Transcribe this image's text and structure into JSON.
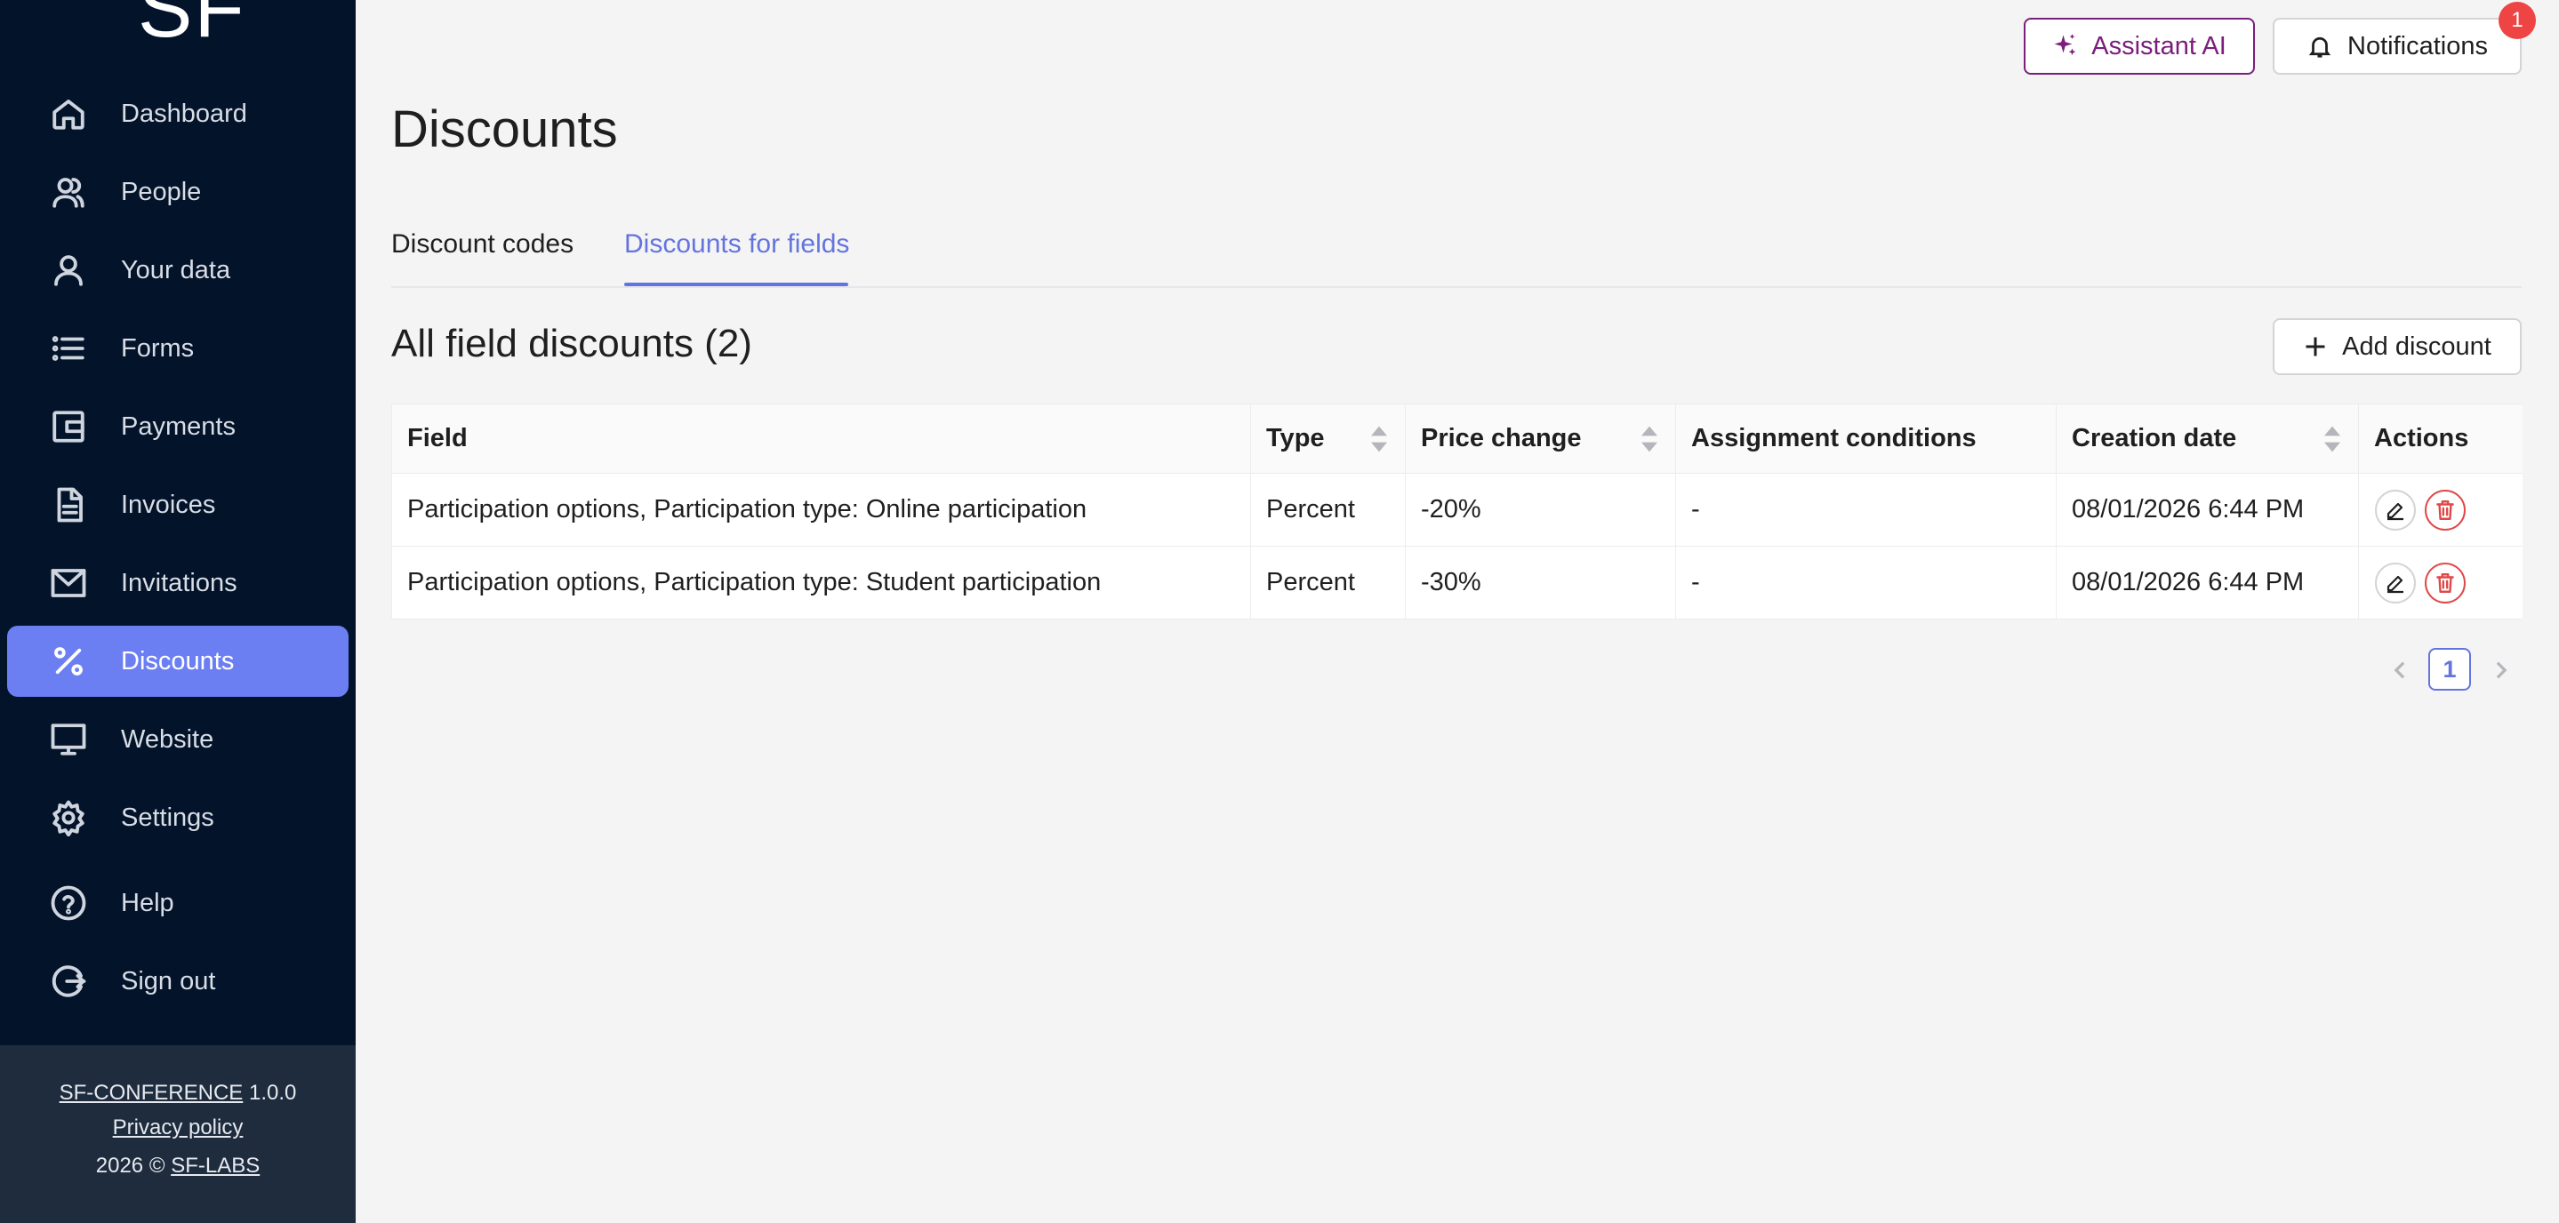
{
  "sidebar": {
    "logo": "SF",
    "items": [
      {
        "label": "Dashboard",
        "icon": "home-icon"
      },
      {
        "label": "People",
        "icon": "people-icon"
      },
      {
        "label": "Your data",
        "icon": "user-icon"
      },
      {
        "label": "Forms",
        "icon": "list-icon"
      },
      {
        "label": "Payments",
        "icon": "wallet-icon"
      },
      {
        "label": "Invoices",
        "icon": "document-icon"
      },
      {
        "label": "Invitations",
        "icon": "mail-icon"
      },
      {
        "label": "Discounts",
        "icon": "percent-icon",
        "active": true
      },
      {
        "label": "Website",
        "icon": "monitor-icon"
      },
      {
        "label": "Settings",
        "icon": "gear-icon"
      },
      {
        "label": "Help",
        "icon": "help-icon"
      },
      {
        "label": "Sign out",
        "icon": "sign-out-icon"
      }
    ],
    "footer": {
      "app_name": "SF-CONFERENCE",
      "version": "1.0.0",
      "privacy": "Privacy policy",
      "copyright_prefix": "2026 ©",
      "company": "SF-LABS"
    }
  },
  "topbar": {
    "assistant_label": "Assistant AI",
    "notifications_label": "Notifications",
    "notifications_count": "1"
  },
  "page": {
    "title": "Discounts",
    "tabs": [
      {
        "label": "Discount codes",
        "active": false
      },
      {
        "label": "Discounts for fields",
        "active": true
      }
    ],
    "section_title": "All field discounts (2)",
    "add_button": "Add discount"
  },
  "table": {
    "columns": [
      "Field",
      "Type",
      "Price change",
      "Assignment conditions",
      "Creation date",
      "Actions"
    ],
    "rows": [
      {
        "field": "Participation options, Participation type: Online participation",
        "type": "Percent",
        "price_change": "-20%",
        "conditions": "-",
        "created": "08/01/2026 6:44 PM"
      },
      {
        "field": "Participation options, Participation type: Student participation",
        "type": "Percent",
        "price_change": "-30%",
        "conditions": "-",
        "created": "08/01/2026 6:44 PM"
      }
    ]
  },
  "pagination": {
    "current": "1"
  },
  "colors": {
    "sidebar_bg": "#03132a",
    "active_nav": "#6c7ff2",
    "accent": "#6474de",
    "assistant": "#7a1e7c",
    "danger": "#e04848"
  }
}
